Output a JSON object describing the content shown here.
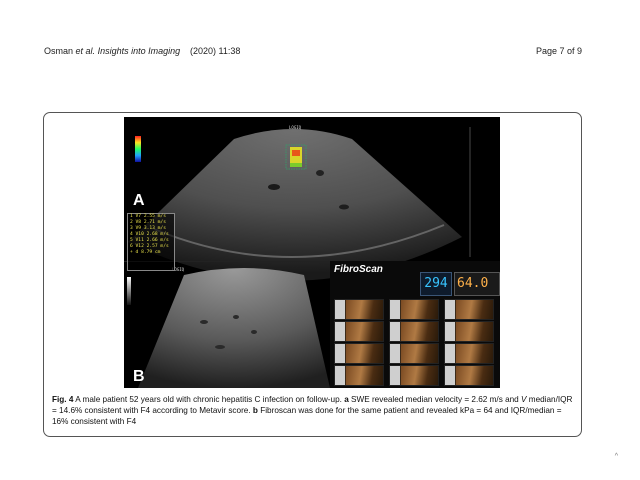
{
  "header": {
    "authors": "Osman",
    "et_al": "et al.",
    "journal": "Insights into Imaging",
    "citation": "(2020) 11:38",
    "page": "Page 7 of 9"
  },
  "figure": {
    "panel_a_letter": "A",
    "panel_b_letter": "B",
    "probe_label_a": "LOGIQ",
    "probe_label_b": "LOGIQ",
    "measurements": [
      "1 V7   2.55 m/s",
      "2 V8   2.71 m/s",
      "3 V9   3.13 m/s",
      "4 V10  2.68 m/s",
      "5 V11  2.66 m/s",
      "6 V12  2.57 m/s",
      "+ d    8.79 cm"
    ],
    "fibroscan_brand": "FibroScan",
    "kpa_value": "294",
    "cap_value": "64.0"
  },
  "caption": {
    "label": "Fig. 4",
    "text_1": " A male patient 52 years old with chronic hepatitis C infection on follow-up. ",
    "a": "a",
    "text_2": " SWE revealed median velocity = 2.62 m/s and ",
    "v_italic": "V",
    "text_3": " median/IQR = 14.6% consistent with F4 according to Metavir score. ",
    "b": "b",
    "text_4": " Fibroscan was done for the same patient and revealed kPa = 64 and IQR/median = 16% consistent with F4"
  }
}
